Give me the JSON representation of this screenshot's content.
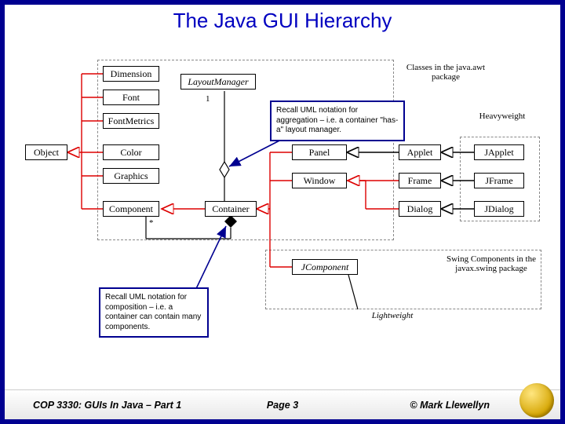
{
  "title": "The Java GUI Hierarchy",
  "boxes": {
    "object": "Object",
    "dimension": "Dimension",
    "font": "Font",
    "fontmetrics": "FontMetrics",
    "color": "Color",
    "graphics": "Graphics",
    "component": "Component",
    "layoutmgr": "LayoutManager",
    "container": "Container",
    "panel": "Panel",
    "window": "Window",
    "jcomponent": "JComponent",
    "applet": "Applet",
    "frame": "Frame",
    "dialog": "Dialog",
    "japplet": "JApplet",
    "jframe": "JFrame",
    "jdialog": "JDialog"
  },
  "labels": {
    "awt_group": "Classes in the java.awt package",
    "swing_group": "Swing Components in the javax.swing package",
    "heavy": "Heavyweight",
    "light": "Lightweight",
    "one": "1",
    "star": "*"
  },
  "callouts": {
    "aggregation": "Recall UML notation for aggregation – i.e. a container \"has-a\" layout manager.",
    "composition": "Recall UML notation for composition – i.e. a container can contain many components."
  },
  "footer": {
    "course": "COP 3330:  GUIs In Java – Part 1",
    "page": "Page 3",
    "copyright": "© Mark Llewellyn"
  }
}
